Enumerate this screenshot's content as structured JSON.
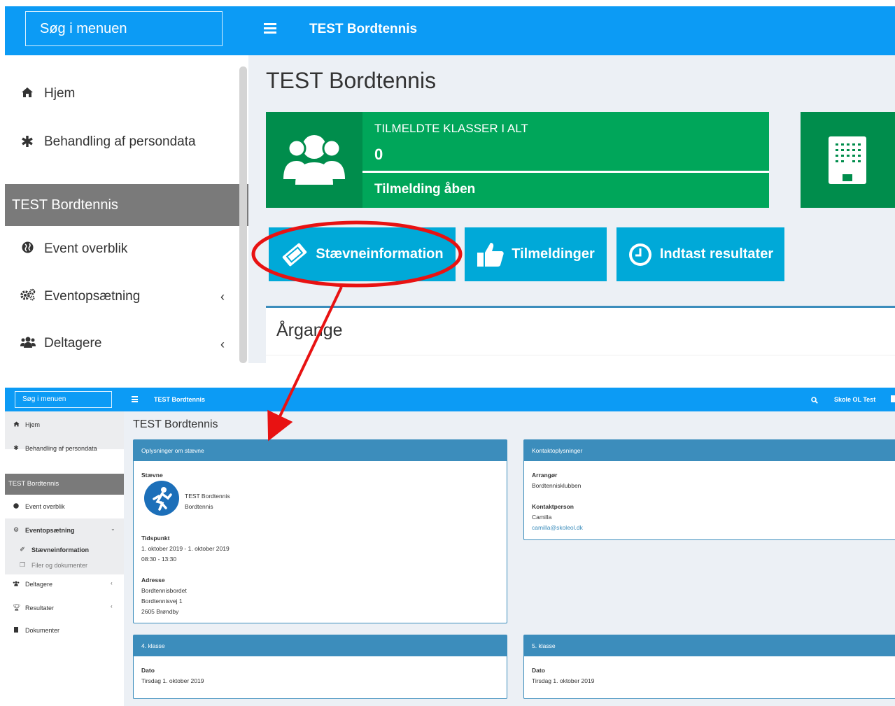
{
  "top": {
    "search_placeholder": "Søg i menuen",
    "header_title": "TEST Bordtennis",
    "sidebar": {
      "items": [
        {
          "label": "Hjem",
          "icon": "home-icon"
        },
        {
          "label": "Behandling af persondata",
          "icon": "asterisk-icon"
        }
      ],
      "section": "TEST Bordtennis",
      "sub_items": [
        {
          "label": "Event overblik",
          "icon": "globe-icon"
        },
        {
          "label": "Eventopsætning",
          "icon": "cogs-icon"
        },
        {
          "label": "Deltagere",
          "icon": "users-icon"
        }
      ]
    },
    "page_title": "TEST Bordtennis",
    "info_box": {
      "label": "TILMELDTE KLASSER I ALT",
      "value": "0",
      "footer": "Tilmelding åben"
    },
    "buttons": {
      "staevne": "Stævneinformation",
      "tilmeldinger": "Tilmeldinger",
      "resultater": "Indtast resultater"
    },
    "panel_title": "Årgange"
  },
  "bottom": {
    "search_placeholder": "Søg i menuen",
    "header_title": "TEST Bordtennis",
    "user": "Skole OL Test",
    "sidebar": {
      "hjem": "Hjem",
      "persondata": "Behandling af persondata",
      "section": "TEST Bordtennis",
      "event_overblik": "Event overblik",
      "eventopsaetning": "Eventopsætning",
      "staevneinformation": "Stævneinformation",
      "filer": "Filer og dokumenter",
      "deltagere": "Deltagere",
      "resultater": "Resultater",
      "dokumenter": "Dokumenter"
    },
    "page_title": "TEST Bordtennis",
    "oplysninger": {
      "header": "Oplysninger om stævne",
      "staevne_label": "Stævne",
      "staevne_name": "TEST Bordtennis",
      "staevne_sport": "Bordtennis",
      "tidspunkt_label": "Tidspunkt",
      "tidspunkt_date": "1. oktober 2019 - 1. oktober 2019",
      "tidspunkt_time": "08:30 - 13:30",
      "adresse_label": "Adresse",
      "adresse_1": "Bordtennisbordet",
      "adresse_2": "Bordtennisvej 1",
      "adresse_3": "2605 Brøndby"
    },
    "kontakt": {
      "header": "Kontaktoplysninger",
      "arrangor_label": "Arrangør",
      "arrangor": "Bordtennisklubben",
      "kontaktperson_label": "Kontaktperson",
      "kontaktperson": "Camilla",
      "email": "camilla@skoleol.dk"
    },
    "klasse4": {
      "header": "4. klasse",
      "dato_label": "Dato",
      "dato": "Tirsdag 1. oktober 2019"
    },
    "klasse5": {
      "header": "5. klasse",
      "dato_label": "Dato",
      "dato": "Tirsdag 1. oktober 2019"
    }
  },
  "colors": {
    "header_blue": "#0c9bf5",
    "green": "#00a65a",
    "dark_green": "#008d4c",
    "button_cyan": "#00a9d8",
    "panel_blue": "#3c8dbc",
    "annotation_red": "#e81212"
  }
}
